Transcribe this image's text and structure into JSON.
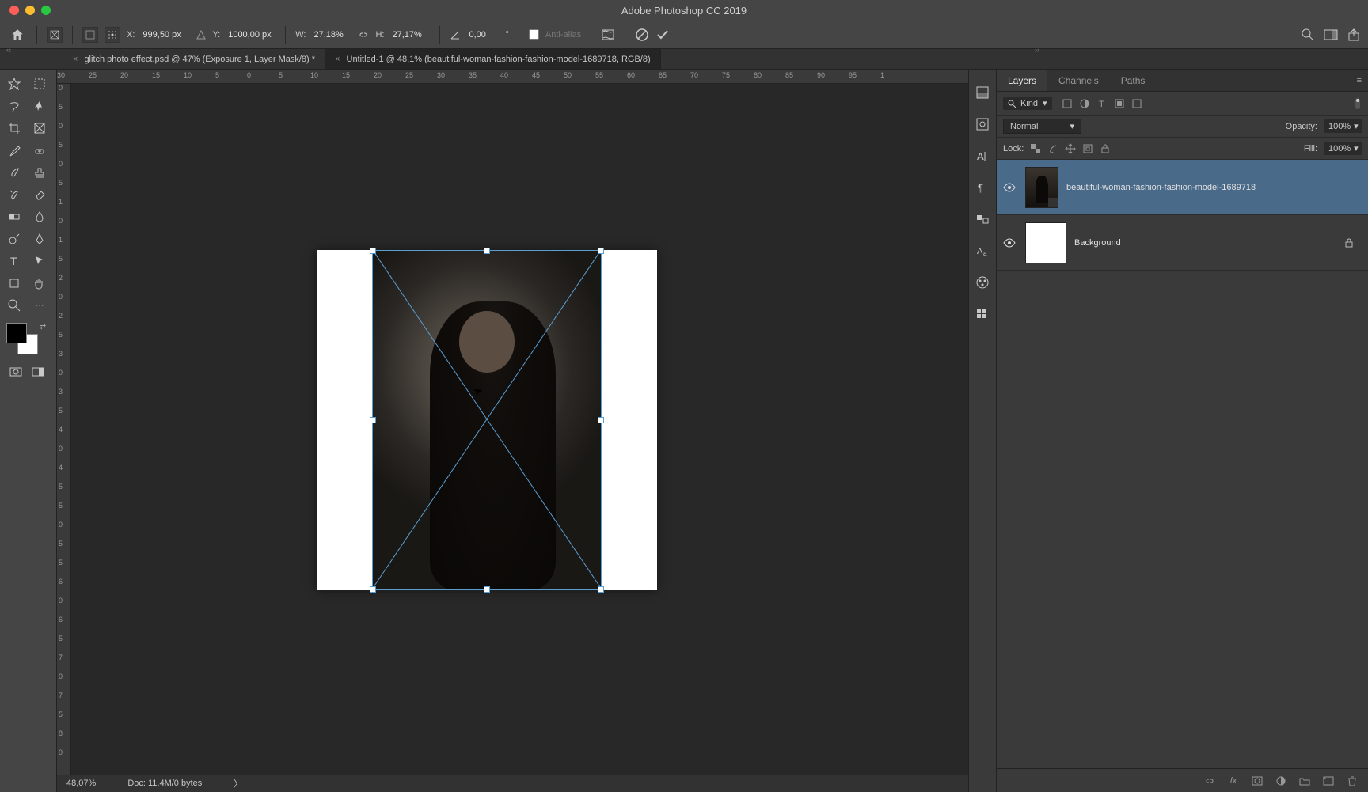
{
  "app_title": "Adobe Photoshop CC 2019",
  "options_bar": {
    "x_label": "X:",
    "x_value": "999,50 px",
    "y_label": "Y:",
    "y_value": "1000,00 px",
    "w_label": "W:",
    "w_value": "27,18%",
    "h_label": "H:",
    "h_value": "27,17%",
    "angle_value": "0,00",
    "antialias_label": "Anti-alias"
  },
  "tabs": [
    {
      "title": "glitch photo effect.psd @ 47% (Exposure 1, Layer Mask/8) *",
      "active": false
    },
    {
      "title": "Untitled-1 @ 48,1% (beautiful-woman-fashion-fashion-model-1689718, RGB/8)",
      "active": true
    }
  ],
  "ruler_h": [
    "30",
    "25",
    "20",
    "15",
    "10",
    "5",
    "0",
    "5",
    "10",
    "15",
    "20",
    "25",
    "30",
    "35",
    "40",
    "45",
    "50",
    "55",
    "60",
    "65",
    "70",
    "75",
    "80",
    "85",
    "90",
    "95",
    "1"
  ],
  "ruler_v": [
    "0",
    "5",
    "0",
    "5",
    "0",
    "5",
    "1",
    "0",
    "1",
    "5",
    "2",
    "0",
    "2",
    "5",
    "3",
    "0",
    "3",
    "5",
    "4",
    "0",
    "4",
    "5",
    "5",
    "0",
    "5",
    "5",
    "6",
    "0",
    "6",
    "5",
    "7",
    "0",
    "7",
    "5",
    "8",
    "0"
  ],
  "status": {
    "zoom": "48,07%",
    "doc": "Doc: 11,4M/0 bytes",
    "arrow": "〉"
  },
  "panels": {
    "tabs": [
      "Layers",
      "Channels",
      "Paths"
    ],
    "kind_label": "Kind",
    "blend_mode": "Normal",
    "opacity_label": "Opacity:",
    "opacity_value": "100%",
    "lock_label": "Lock:",
    "fill_label": "Fill:",
    "fill_value": "100%",
    "layers": [
      {
        "name": "beautiful-woman-fashion-fashion-model-1689718",
        "selected": true,
        "locked": false
      },
      {
        "name": "Background",
        "selected": false,
        "locked": true
      }
    ]
  }
}
